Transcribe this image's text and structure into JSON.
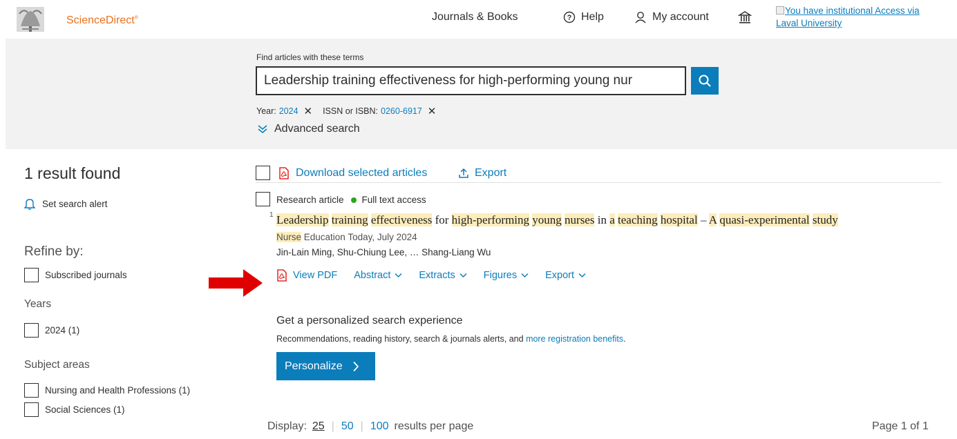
{
  "header": {
    "logo_text": "ScienceDirect",
    "logo_mark": "®",
    "nav_journals": "Journals & Books",
    "nav_help": "Help",
    "nav_account": "My account",
    "institution_link": "You have institutional Access via Laval University"
  },
  "search": {
    "label": "Find articles with these terms",
    "value": "Leadership training effectiveness for high-performing young nur",
    "filters": [
      {
        "label": "Year:",
        "value": "2024",
        "remove": "✕"
      },
      {
        "label": "ISSN or ISBN:",
        "value": "0260-6917",
        "remove": "✕"
      }
    ],
    "advanced_label": "Advanced search"
  },
  "sidebar": {
    "results_count": "1 result found",
    "alert_label": "Set search alert",
    "refine_label": "Refine by:",
    "subscribed_label": "Subscribed journals",
    "years_heading": "Years",
    "years": [
      {
        "label": "2024 (1)"
      }
    ],
    "subject_heading": "Subject areas",
    "subjects": [
      {
        "label": "Nursing and Health Professions (1)"
      },
      {
        "label": "Social Sciences (1)"
      }
    ]
  },
  "results": {
    "download_label": "Download selected articles",
    "export_label": "Export",
    "items": [
      {
        "number": "1",
        "type": "Research article",
        "access": "Full text access",
        "title_parts": [
          {
            "t": "Leadership",
            "hl": true
          },
          {
            "t": " ",
            "hl": false
          },
          {
            "t": "training",
            "hl": true
          },
          {
            "t": " ",
            "hl": false
          },
          {
            "t": "effectiveness",
            "hl": true
          },
          {
            "t": " for ",
            "hl": false
          },
          {
            "t": "high-performing",
            "hl": true
          },
          {
            "t": " ",
            "hl": false
          },
          {
            "t": "young",
            "hl": true
          },
          {
            "t": " ",
            "hl": false
          },
          {
            "t": "nurses",
            "hl": true
          },
          {
            "t": " in ",
            "hl": false
          },
          {
            "t": "a",
            "hl": true
          },
          {
            "t": " ",
            "hl": false
          },
          {
            "t": "teaching",
            "hl": true
          },
          {
            "t": " ",
            "hl": false
          },
          {
            "t": "hospital",
            "hl": true
          },
          {
            "t": " – ",
            "hl": false
          },
          {
            "t": "A",
            "hl": true
          },
          {
            "t": " ",
            "hl": false
          },
          {
            "t": "quasi-experimental",
            "hl": true
          },
          {
            "t": " ",
            "hl": false
          },
          {
            "t": "study",
            "hl": true
          }
        ],
        "journal_highlight": "Nurse",
        "journal_rest": " Education Today, July 2024",
        "authors": "Jin-Lain Ming, Shu-Chiung Lee, … Shang-Liang Wu",
        "actions": {
          "view_pdf": "View PDF",
          "abstract": "Abstract",
          "extracts": "Extracts",
          "figures": "Figures",
          "export": "Export"
        }
      }
    ]
  },
  "personalize": {
    "title": "Get a personalized search experience",
    "desc": "Recommendations, reading history, search & journals alerts, and ",
    "desc_link": "more registration benefits",
    "desc_end": ".",
    "button": "Personalize"
  },
  "footer": {
    "display_label": "Display:",
    "current": "25",
    "option_50": "50",
    "option_100": "100",
    "suffix": "results per page",
    "page_indicator": "Page 1 of 1"
  },
  "colors": {
    "accent": "#0c7dbb",
    "brand": "#e9711c",
    "highlight": "#fdedbb",
    "access_dot": "#29a61b",
    "annotation_arrow": "#e00000"
  },
  "icons": [
    "elsevier-tree-icon",
    "help-icon",
    "account-icon",
    "institution-icon",
    "search-icon",
    "chevrons-down-icon",
    "bell-icon",
    "pdf-icon",
    "export-icon",
    "chevron-down-icon",
    "chevron-right-icon",
    "red-arrow-annotation"
  ]
}
